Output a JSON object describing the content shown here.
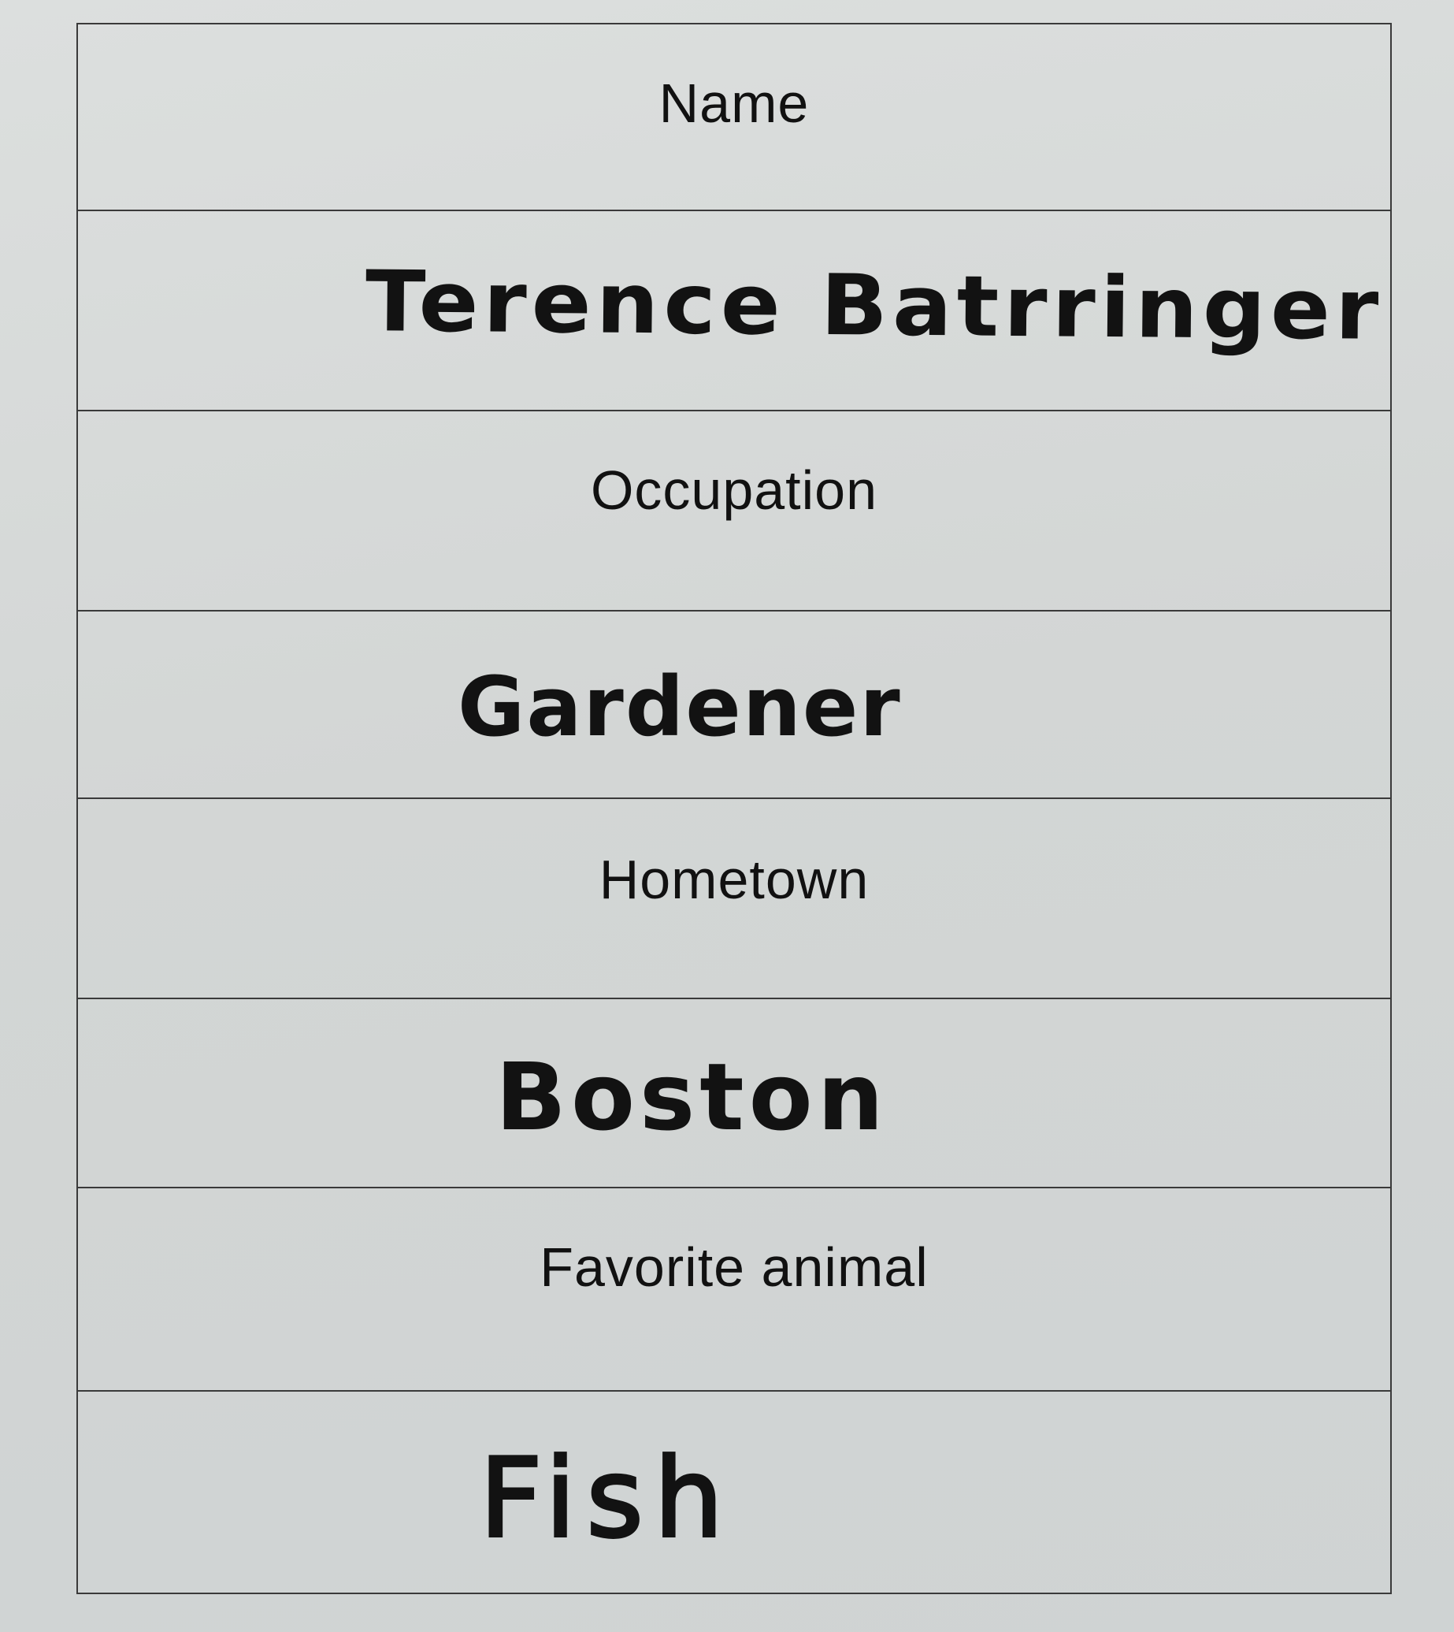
{
  "form": {
    "fields": [
      {
        "label": "Name",
        "value": "Terence Batrringer"
      },
      {
        "label": "Occupation",
        "value": "Gardener"
      },
      {
        "label": "Hometown",
        "value": "Boston"
      },
      {
        "label": "Favorite animal",
        "value": "Fish"
      }
    ]
  },
  "colors": {
    "paper": "#d6d9d8",
    "ink": "#121212",
    "rule": "#3a3a3a"
  }
}
